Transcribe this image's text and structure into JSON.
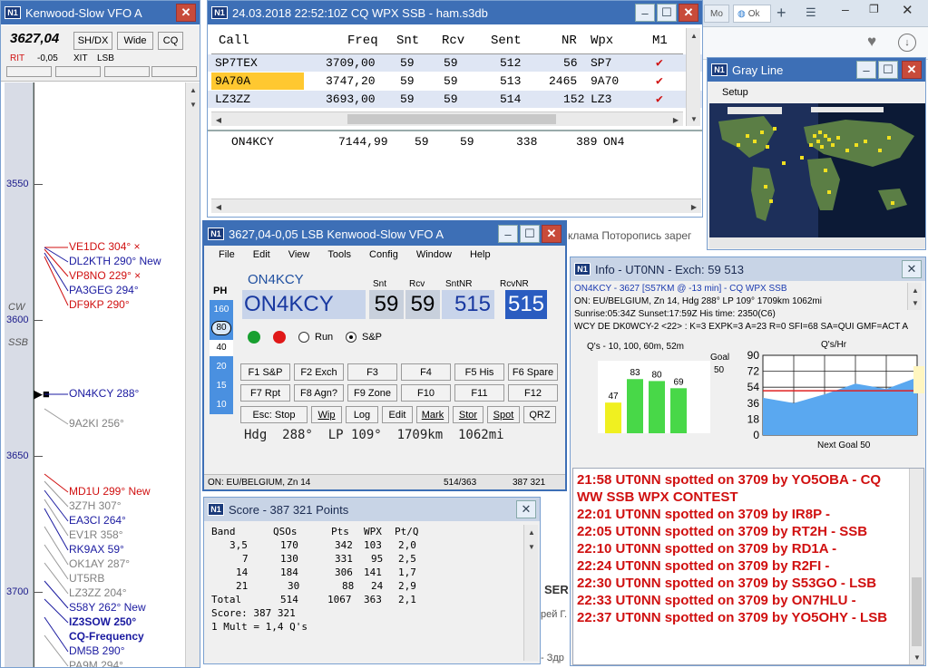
{
  "vfo": {
    "title": "Kenwood-Slow VFO A",
    "freq": "3627,04",
    "buttons": [
      "SH/DX",
      "Wide",
      "CQ"
    ],
    "rit_label": "RIT",
    "rit_value": "-0,05",
    "xit_label": "XIT",
    "mode": "LSB",
    "mode_band_labels": [
      "CW",
      "SSB"
    ],
    "freq_scale": [
      "3550",
      "3600",
      "3650",
      "3700"
    ],
    "spots": [
      {
        "text": "VE1DC 304° ×",
        "color": "red"
      },
      {
        "text": "DL2KTH 290° New",
        "color": "blue"
      },
      {
        "text": "VP8NO 229° ×",
        "color": "red"
      },
      {
        "text": "PA3GEG 294°",
        "color": "blue"
      },
      {
        "text": "DF9KP 290°",
        "color": "red"
      },
      {
        "text": "ON4KCY 288°",
        "color": "blue"
      },
      {
        "text": "9A2KI 256°",
        "color": "gray"
      },
      {
        "text": "MD1U 299° New",
        "color": "red"
      },
      {
        "text": "3Z7H 307°",
        "color": "gray"
      },
      {
        "text": "EA3CI 264°",
        "color": "blue"
      },
      {
        "text": "EV1R 358°",
        "color": "gray"
      },
      {
        "text": "RK9AX 59°",
        "color": "blue"
      },
      {
        "text": "OK1AY 287°",
        "color": "gray"
      },
      {
        "text": "UT5RB",
        "color": "gray"
      },
      {
        "text": "LZ3ZZ 204°",
        "color": "gray"
      },
      {
        "text": "S58Y 262° New",
        "color": "blue"
      },
      {
        "text": "IZ3SOW 250°",
        "color": "blue-bold"
      },
      {
        "text": "CQ-Frequency",
        "color": "blue-bold"
      },
      {
        "text": "DM5B 290°",
        "color": "blue"
      },
      {
        "text": "PA9M 294°",
        "color": "gray"
      }
    ]
  },
  "log": {
    "title": "24.03.2018 22:52:10Z  CQ WPX SSB - ham.s3db",
    "columns": [
      "Call",
      "Freq",
      "Snt",
      "Rcv",
      "Sent",
      "NR",
      "Wpx",
      "M1"
    ],
    "rows": [
      {
        "call": "SP7TEX",
        "freq": "3709,00",
        "snt": "59",
        "rcv": "59",
        "sent": "512",
        "nr": "56",
        "wpx": "SP7",
        "m1": "✔"
      },
      {
        "call": "9A70A",
        "freq": "3747,20",
        "snt": "59",
        "rcv": "59",
        "sent": "513",
        "nr": "2465",
        "wpx": "9A70",
        "m1": "✔"
      },
      {
        "call": "LZ3ZZ",
        "freq": "3693,00",
        "snt": "59",
        "rcv": "59",
        "sent": "514",
        "nr": "152",
        "wpx": "LZ3",
        "m1": "✔"
      }
    ],
    "current": {
      "call": "ON4KCY",
      "freq": "7144,99",
      "snt": "59",
      "rcv": "59",
      "sent": "338",
      "nr": "389",
      "wpx": "ON4"
    }
  },
  "browser": {
    "tabs": [
      "Mo",
      "Ok"
    ],
    "text_fragment": "клама Поторопись зарег",
    "text2": "SER",
    "text3": "рей Г.",
    "text4": "- Здр"
  },
  "grayline": {
    "title": "Gray Line",
    "menu": "Setup"
  },
  "entry": {
    "title": "3627,04-0,05 LSB Kenwood-Slow VFO A",
    "menu": [
      "File",
      "Edit",
      "View",
      "Tools",
      "Config",
      "Window",
      "Help"
    ],
    "callsign_label": "ON4KCY",
    "callsign": "ON4KCY",
    "fields": [
      {
        "label": "Snt",
        "value": "59"
      },
      {
        "label": "Rcv",
        "value": "59"
      },
      {
        "label": "SntNR",
        "value": "515"
      },
      {
        "label": "RcvNR",
        "value": "515"
      }
    ],
    "mode_label": "PH",
    "bands": [
      "160",
      "80",
      "40",
      "20",
      "15",
      "10"
    ],
    "run_label": "Run",
    "sp_label": "S&P",
    "fkeys_row1": [
      "F1 S&P",
      "F2 Exch",
      "F3",
      "F4",
      "F5 His",
      "F6 Spare"
    ],
    "fkeys_row2": [
      "F7 Rpt",
      "F8 Agn?",
      "F9 Zone",
      "F10",
      "F11",
      "F12"
    ],
    "fkeys_row3": [
      "Esc: Stop",
      "Wip",
      "Log",
      "Edit",
      "Mark",
      "Stor",
      "Spot",
      "QRZ"
    ],
    "heading": "Hdg  288°  LP 109°  1709km  1062mi",
    "status_left": "ON: EU/BELGIUM, Zn 14",
    "status_mid": "514/363",
    "status_right": "387 321"
  },
  "score": {
    "title": "Score - 387 321 Points",
    "header": [
      "Band",
      "QSOs",
      "Pts",
      "WPX",
      "Pt/Q"
    ],
    "rows": [
      [
        "3,5",
        "170",
        "342",
        "103",
        "2,0"
      ],
      [
        "7",
        "130",
        "331",
        "95",
        "2,5"
      ],
      [
        "14",
        "184",
        "306",
        "141",
        "1,7"
      ],
      [
        "21",
        "30",
        "88",
        "24",
        "2,9"
      ],
      [
        "Total",
        "514",
        "1067",
        "363",
        "2,1"
      ]
    ],
    "score_line": "Score: 387 321",
    "mult_line": "1 Mult = 1,4 Q's"
  },
  "info": {
    "title": "Info - UT0NN - Exch: 59 513",
    "line1": "ON4KCY - 3627 [S57KM @ -13 min] - CQ WPX SSB",
    "line2": "ON: EU/BELGIUM, Zn 14, Hdg  288°  LP 109°  1709km  1062mi",
    "line3": "Sunrise:05:34Z Sunset:17:59Z His time: 2350(C6)",
    "line4": "WCY DE DK0WCY-2 <22> : K=3 EXPK=3 A=23 R=0 SFI=68 SA=QUI GMF=ACT A",
    "qs_chart_title": "Q's - 10, 100, 60m, 52m",
    "goal_label": "Goal",
    "goal_value": "50",
    "qshr_title": "Q's/Hr",
    "next_goal": "Next Goal 50",
    "spots": [
      "21:58 UT0NN spotted on 3709 by YO5OBA - CQ",
      "WW SSB WPX CONTEST",
      "22:01 UT0NN spotted on 3709 by IR8P -",
      "22:05 UT0NN spotted on 3709 by RT2H - SSB",
      "22:10 UT0NN spotted on 3709 by RD1A -",
      "22:24 UT0NN spotted on 3709 by R2FI -",
      "22:30 UT0NN spotted on 3709 by S53GO - LSB",
      "22:33 UT0NN spotted on 3709 by ON7HLU -",
      "22:37 UT0NN spotted on 3709 by YO5OHY - LSB"
    ]
  },
  "chart_data": [
    {
      "type": "bar",
      "title": "Q's - 10, 100, 60m, 52m",
      "categories": [
        "10",
        "100",
        "60m",
        "52m"
      ],
      "values": [
        47,
        83,
        80,
        69
      ],
      "goal": 50
    },
    {
      "type": "area",
      "title": "Q's/Hr",
      "yticks": [
        0,
        18,
        36,
        54,
        72,
        90
      ],
      "ylim": [
        0,
        90
      ],
      "x": [
        0,
        1,
        2,
        3,
        4,
        5
      ],
      "values": [
        42,
        36,
        46,
        58,
        52,
        65
      ],
      "goal_line": 50,
      "xlabel": "Next Goal 50"
    }
  ]
}
